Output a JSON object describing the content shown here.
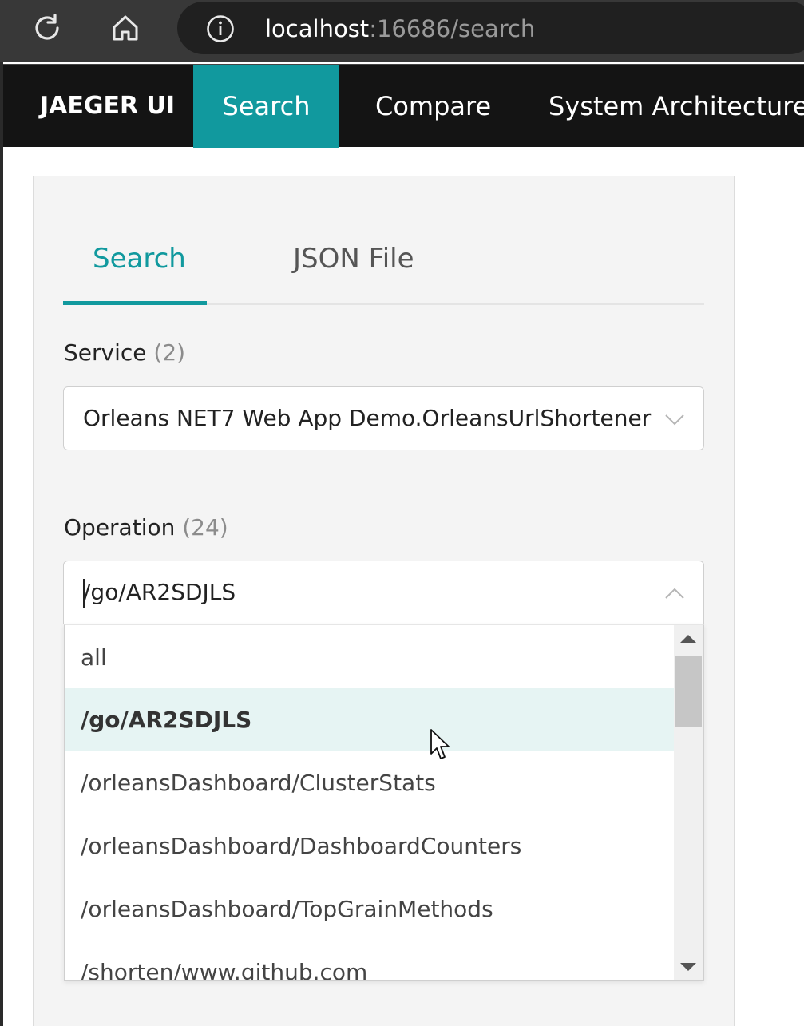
{
  "browser": {
    "reload_icon": "reload-icon",
    "home_icon": "home-icon",
    "info_icon": "info-icon",
    "url_host": "localhost",
    "url_rest": ":16686/search"
  },
  "nav": {
    "brand": "JAEGER UI",
    "items": [
      {
        "label": "Search",
        "active": true
      },
      {
        "label": "Compare",
        "active": false
      },
      {
        "label": "System Architecture",
        "active": false
      }
    ]
  },
  "tabs": [
    {
      "label": "Search",
      "active": true
    },
    {
      "label": "JSON File",
      "active": false
    }
  ],
  "service": {
    "label": "Service",
    "count": "(2)",
    "value": "Orleans NET7 Web App Demo.OrleansUrlShortener"
  },
  "operation": {
    "label": "Operation",
    "count": "(24)",
    "value": "/go/AR2SDJLS",
    "options": [
      "all",
      "/go/AR2SDJLS",
      "/orleansDashboard/ClusterStats",
      "/orleansDashboard/DashboardCounters",
      "/orleansDashboard/TopGrainMethods",
      "/shorten/www.github.com"
    ],
    "highlighted_option": "/go/AR2SDJLS"
  },
  "colors": {
    "accent": "#11999e",
    "nav_bg": "#141414",
    "highlight_bg": "#e6f4f3"
  }
}
